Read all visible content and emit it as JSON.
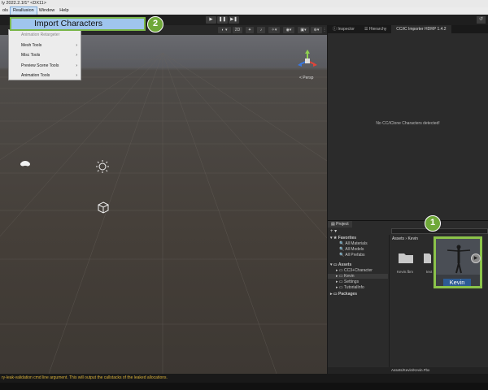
{
  "window": {
    "title": "ly 2022.2.1f1* <DX11>"
  },
  "menubar": {
    "items": [
      "ols",
      "Reallusion",
      "Window",
      "Help"
    ]
  },
  "toolbar": {
    "play": "▶",
    "pause": "❚❚",
    "step": "▶❚",
    "undo": "↺"
  },
  "scene": {
    "mode_2d": "2D",
    "persp_label": "< Persp",
    "gizmo_x": "x",
    "gizmo_y": "y",
    "gizmo_z": "z"
  },
  "reallusion_menu": {
    "highlighted": "Import Characters",
    "items": [
      {
        "label": "Animation Retargeter",
        "submenu": false,
        "disabled": true
      },
      {
        "label": "Mesh Tools",
        "submenu": true,
        "disabled": false
      },
      {
        "label": "Misc Tools",
        "submenu": true,
        "disabled": false
      },
      {
        "label": "Preview Scene Tools",
        "submenu": true,
        "disabled": false
      },
      {
        "label": "Animation Tools",
        "submenu": true,
        "disabled": false
      }
    ]
  },
  "right_tabs": [
    "Inspector",
    "Hierarchy",
    "CC/iC Importer HDRP 1.4.2"
  ],
  "cc_importer": {
    "message": "No CC/iClone Characters detected!"
  },
  "project": {
    "tab": "Project",
    "plus": "+ ▾",
    "tree": {
      "favorites": "Favorites",
      "fav_items": [
        "All Materials",
        "All Models",
        "All Prefabs"
      ],
      "assets": "Assets",
      "asset_items": [
        "CC3+Character",
        "Kevin",
        "Settings",
        "TutorialInfo"
      ],
      "packages": "Packages"
    },
    "breadcrumb": "Assets › Kevin",
    "folders": [
      "Kevin.fbm",
      "text"
    ],
    "selected_asset": "Kevin",
    "path": "Assets/Kevin/Kevin.Fbx"
  },
  "badges": {
    "step1": "1",
    "step2": "2"
  },
  "status": {
    "message": "ry-leak-validation cmd line argument. This will output the callstacks of the leaked allocations."
  },
  "colors": {
    "badge_green": "#6fa839",
    "highlight_blue": "#9fc5ee",
    "selection_blue": "#2d5b94",
    "frame_green": "#8bc34a"
  }
}
